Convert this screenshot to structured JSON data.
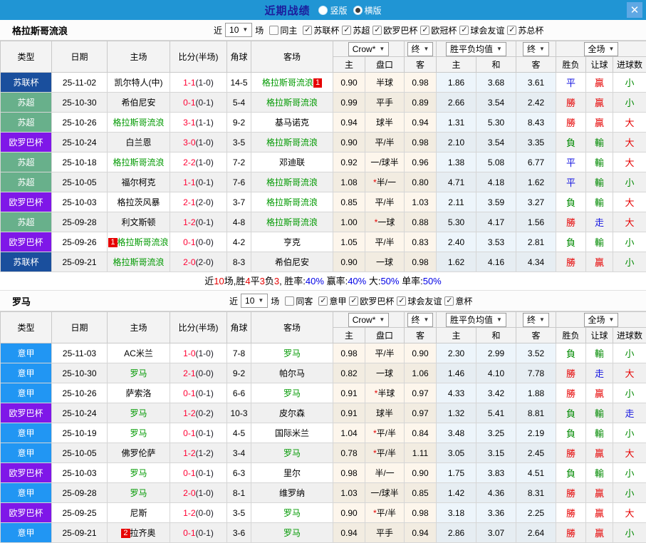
{
  "topbar": {
    "title": "近期战绩",
    "vertical_label": "竖版",
    "horizontal_label": "横版",
    "close": "✕"
  },
  "colors": {
    "topbar_bg": "#2095d4",
    "title": "#1c1c9c",
    "red": "#e60000",
    "blue": "#0000e6",
    "score_red": "#ff0033",
    "team_green": "#009900",
    "type": {
      "苏联杯": "#1a4f9d",
      "苏超": "#68b08b",
      "欧罗巴杯": "#7f17e8",
      "意甲": "#2196f3"
    },
    "result": {
      "勝": "#e60000",
      "負": "#008a00",
      "平": "#1515e0",
      "贏": "#e60000",
      "輸": "#008a00",
      "走": "#1515e0",
      "大": "#e60000",
      "小": "#008a00"
    }
  },
  "sections": [
    {
      "team": "格拉斯哥流浪",
      "filters": {
        "near_label": "近",
        "count": "10",
        "games_label": "场",
        "same_label": "同主",
        "same_checked": false,
        "leagues": [
          "苏联杯",
          "苏超",
          "欧罗巴杯",
          "欧冠杯",
          "球会友谊",
          "苏总杯"
        ]
      },
      "dropdowns": {
        "company": "Crow*",
        "final1": "终",
        "avg": "胜平负均值",
        "final2": "终",
        "scope": "全场"
      },
      "columns": [
        "类型",
        "日期",
        "主场",
        "比分(半场)",
        "角球",
        "客场"
      ],
      "subcolumns": [
        "主",
        "盘口",
        "客",
        "主",
        "和",
        "客",
        "胜负",
        "让球",
        "进球数"
      ],
      "rows": [
        {
          "type": "苏联杯",
          "date": "25-11-02",
          "home": {
            "name": "凯尔特人(中)",
            "green": false
          },
          "score": "1-1",
          "half": "(1-0)",
          "corner": "14-5",
          "away": {
            "name": "格拉斯哥流浪",
            "green": true,
            "badge": "1",
            "pos": "after"
          },
          "ah": [
            "0.90",
            "半球",
            "0.98"
          ],
          "eu": [
            "1.86",
            "3.68",
            "3.61"
          ],
          "res": [
            "平",
            "贏",
            "小"
          ]
        },
        {
          "type": "苏超",
          "date": "25-10-30",
          "home": {
            "name": "希伯尼安",
            "green": false
          },
          "score": "0-1",
          "half": "(0-1)",
          "corner": "5-4",
          "away": {
            "name": "格拉斯哥流浪",
            "green": true
          },
          "ah": [
            "0.99",
            "平手",
            "0.89"
          ],
          "eu": [
            "2.66",
            "3.54",
            "2.42"
          ],
          "res": [
            "勝",
            "贏",
            "小"
          ]
        },
        {
          "type": "苏超",
          "date": "25-10-26",
          "home": {
            "name": "格拉斯哥流浪",
            "green": true
          },
          "score": "3-1",
          "half": "(1-1)",
          "corner": "9-2",
          "away": {
            "name": "基马诺克",
            "green": false
          },
          "ah": [
            "0.94",
            "球半",
            "0.94"
          ],
          "eu": [
            "1.31",
            "5.30",
            "8.43"
          ],
          "res": [
            "勝",
            "贏",
            "大"
          ]
        },
        {
          "type": "欧罗巴杯",
          "date": "25-10-24",
          "home": {
            "name": "白兰恩",
            "green": false
          },
          "score": "3-0",
          "half": "(1-0)",
          "corner": "3-5",
          "away": {
            "name": "格拉斯哥流浪",
            "green": true
          },
          "ah": [
            "0.90",
            "平/半",
            "0.98"
          ],
          "eu": [
            "2.10",
            "3.54",
            "3.35"
          ],
          "res": [
            "負",
            "輸",
            "大"
          ]
        },
        {
          "type": "苏超",
          "date": "25-10-18",
          "home": {
            "name": "格拉斯哥流浪",
            "green": true
          },
          "score": "2-2",
          "half": "(1-0)",
          "corner": "7-2",
          "away": {
            "name": "邓迪联",
            "green": false
          },
          "ah": [
            "0.92",
            "一/球半",
            "0.96"
          ],
          "eu": [
            "1.38",
            "5.08",
            "6.77"
          ],
          "res": [
            "平",
            "輸",
            "大"
          ]
        },
        {
          "type": "苏超",
          "date": "25-10-05",
          "home": {
            "name": "福尔柯克",
            "green": false
          },
          "score": "1-1",
          "half": "(0-1)",
          "corner": "7-6",
          "away": {
            "name": "格拉斯哥流浪",
            "green": true
          },
          "ah": [
            "1.08",
            "*半/一",
            "0.80"
          ],
          "eu": [
            "4.71",
            "4.18",
            "1.62"
          ],
          "res": [
            "平",
            "輸",
            "小"
          ]
        },
        {
          "type": "欧罗巴杯",
          "date": "25-10-03",
          "home": {
            "name": "格拉茨风暴",
            "green": false
          },
          "score": "2-1",
          "half": "(2-0)",
          "corner": "3-7",
          "away": {
            "name": "格拉斯哥流浪",
            "green": true
          },
          "ah": [
            "0.85",
            "平/半",
            "1.03"
          ],
          "eu": [
            "2.11",
            "3.59",
            "3.27"
          ],
          "res": [
            "負",
            "輸",
            "大"
          ]
        },
        {
          "type": "苏超",
          "date": "25-09-28",
          "home": {
            "name": "利文斯顿",
            "green": false
          },
          "score": "1-2",
          "half": "(0-1)",
          "corner": "4-8",
          "away": {
            "name": "格拉斯哥流浪",
            "green": true
          },
          "ah": [
            "1.00",
            "*一球",
            "0.88"
          ],
          "eu": [
            "5.30",
            "4.17",
            "1.56"
          ],
          "res": [
            "勝",
            "走",
            "大"
          ]
        },
        {
          "type": "欧罗巴杯",
          "date": "25-09-26",
          "home": {
            "name": "格拉斯哥流浪",
            "green": true,
            "badge": "1",
            "pos": "before"
          },
          "score": "0-1",
          "half": "(0-0)",
          "corner": "4-2",
          "away": {
            "name": "亨克",
            "green": false
          },
          "ah": [
            "1.05",
            "平/半",
            "0.83"
          ],
          "eu": [
            "2.40",
            "3.53",
            "2.81"
          ],
          "res": [
            "負",
            "輸",
            "小"
          ]
        },
        {
          "type": "苏联杯",
          "date": "25-09-21",
          "home": {
            "name": "格拉斯哥流浪",
            "green": true
          },
          "score": "2-0",
          "half": "(2-0)",
          "corner": "8-3",
          "away": {
            "name": "希伯尼安",
            "green": false
          },
          "ah": [
            "0.90",
            "一球",
            "0.98"
          ],
          "eu": [
            "1.62",
            "4.16",
            "4.34"
          ],
          "res": [
            "勝",
            "贏",
            "小"
          ]
        }
      ],
      "summary": [
        {
          "t": "近",
          "c": ""
        },
        {
          "t": "10",
          "c": "red"
        },
        {
          "t": "场,胜",
          "c": ""
        },
        {
          "t": "4",
          "c": "red"
        },
        {
          "t": "平",
          "c": ""
        },
        {
          "t": "3",
          "c": "red"
        },
        {
          "t": "负",
          "c": ""
        },
        {
          "t": "3",
          "c": "red"
        },
        {
          "t": ", 胜率:",
          "c": ""
        },
        {
          "t": "40%",
          "c": "blue"
        },
        {
          "t": " 赢率:",
          "c": ""
        },
        {
          "t": "40%",
          "c": "blue"
        },
        {
          "t": " 大:",
          "c": ""
        },
        {
          "t": "50%",
          "c": "blue"
        },
        {
          "t": " 单率:",
          "c": ""
        },
        {
          "t": "50%",
          "c": "blue"
        }
      ]
    },
    {
      "team": "罗马",
      "filters": {
        "near_label": "近",
        "count": "10",
        "games_label": "场",
        "same_label": "同客",
        "same_checked": false,
        "leagues": [
          "意甲",
          "欧罗巴杯",
          "球会友谊",
          "意杯"
        ]
      },
      "dropdowns": {
        "company": "Crow*",
        "final1": "终",
        "avg": "胜平负均值",
        "final2": "终",
        "scope": "全场"
      },
      "columns": [
        "类型",
        "日期",
        "主场",
        "比分(半场)",
        "角球",
        "客场"
      ],
      "subcolumns": [
        "主",
        "盘口",
        "客",
        "主",
        "和",
        "客",
        "胜负",
        "让球",
        "进球数"
      ],
      "rows": [
        {
          "type": "意甲",
          "date": "25-11-03",
          "home": {
            "name": "AC米兰",
            "green": false
          },
          "score": "1-0",
          "half": "(1-0)",
          "corner": "7-8",
          "away": {
            "name": "罗马",
            "green": true
          },
          "ah": [
            "0.98",
            "平/半",
            "0.90"
          ],
          "eu": [
            "2.30",
            "2.99",
            "3.52"
          ],
          "res": [
            "負",
            "輸",
            "小"
          ]
        },
        {
          "type": "意甲",
          "date": "25-10-30",
          "home": {
            "name": "罗马",
            "green": true
          },
          "score": "2-1",
          "half": "(0-0)",
          "corner": "9-2",
          "away": {
            "name": "帕尔马",
            "green": false
          },
          "ah": [
            "0.82",
            "一球",
            "1.06"
          ],
          "eu": [
            "1.46",
            "4.10",
            "7.78"
          ],
          "res": [
            "勝",
            "走",
            "大"
          ]
        },
        {
          "type": "意甲",
          "date": "25-10-26",
          "home": {
            "name": "萨索洛",
            "green": false
          },
          "score": "0-1",
          "half": "(0-1)",
          "corner": "6-6",
          "away": {
            "name": "罗马",
            "green": true
          },
          "ah": [
            "0.91",
            "*半球",
            "0.97"
          ],
          "eu": [
            "4.33",
            "3.42",
            "1.88"
          ],
          "res": [
            "勝",
            "贏",
            "小"
          ]
        },
        {
          "type": "欧罗巴杯",
          "date": "25-10-24",
          "home": {
            "name": "罗马",
            "green": true
          },
          "score": "1-2",
          "half": "(0-2)",
          "corner": "10-3",
          "away": {
            "name": "皮尔森",
            "green": false
          },
          "ah": [
            "0.91",
            "球半",
            "0.97"
          ],
          "eu": [
            "1.32",
            "5.41",
            "8.81"
          ],
          "res": [
            "負",
            "輸",
            "走"
          ]
        },
        {
          "type": "意甲",
          "date": "25-10-19",
          "home": {
            "name": "罗马",
            "green": true
          },
          "score": "0-1",
          "half": "(0-1)",
          "corner": "4-5",
          "away": {
            "name": "国际米兰",
            "green": false
          },
          "ah": [
            "1.04",
            "*平/半",
            "0.84"
          ],
          "eu": [
            "3.48",
            "3.25",
            "2.19"
          ],
          "res": [
            "負",
            "輸",
            "小"
          ]
        },
        {
          "type": "意甲",
          "date": "25-10-05",
          "home": {
            "name": "佛罗伦萨",
            "green": false
          },
          "score": "1-2",
          "half": "(1-2)",
          "corner": "3-4",
          "away": {
            "name": "罗马",
            "green": true
          },
          "ah": [
            "0.78",
            "*平/半",
            "1.11"
          ],
          "eu": [
            "3.05",
            "3.15",
            "2.45"
          ],
          "res": [
            "勝",
            "贏",
            "大"
          ]
        },
        {
          "type": "欧罗巴杯",
          "date": "25-10-03",
          "home": {
            "name": "罗马",
            "green": true
          },
          "score": "0-1",
          "half": "(0-1)",
          "corner": "6-3",
          "away": {
            "name": "里尔",
            "green": false
          },
          "ah": [
            "0.98",
            "半/一",
            "0.90"
          ],
          "eu": [
            "1.75",
            "3.83",
            "4.51"
          ],
          "res": [
            "負",
            "輸",
            "小"
          ]
        },
        {
          "type": "意甲",
          "date": "25-09-28",
          "home": {
            "name": "罗马",
            "green": true
          },
          "score": "2-0",
          "half": "(1-0)",
          "corner": "8-1",
          "away": {
            "name": "维罗纳",
            "green": false
          },
          "ah": [
            "1.03",
            "一/球半",
            "0.85"
          ],
          "eu": [
            "1.42",
            "4.36",
            "8.31"
          ],
          "res": [
            "勝",
            "贏",
            "小"
          ]
        },
        {
          "type": "欧罗巴杯",
          "date": "25-09-25",
          "home": {
            "name": "尼斯",
            "green": false
          },
          "score": "1-2",
          "half": "(0-0)",
          "corner": "3-5",
          "away": {
            "name": "罗马",
            "green": true
          },
          "ah": [
            "0.90",
            "*平/半",
            "0.98"
          ],
          "eu": [
            "3.18",
            "3.36",
            "2.25"
          ],
          "res": [
            "勝",
            "贏",
            "大"
          ]
        },
        {
          "type": "意甲",
          "date": "25-09-21",
          "home": {
            "name": "拉齐奥",
            "green": false,
            "badge": "2",
            "pos": "before"
          },
          "score": "0-1",
          "half": "(0-1)",
          "corner": "3-6",
          "away": {
            "name": "罗马",
            "green": true
          },
          "ah": [
            "0.94",
            "平手",
            "0.94"
          ],
          "eu": [
            "2.86",
            "3.07",
            "2.64"
          ],
          "res": [
            "勝",
            "贏",
            "小"
          ]
        }
      ]
    }
  ]
}
